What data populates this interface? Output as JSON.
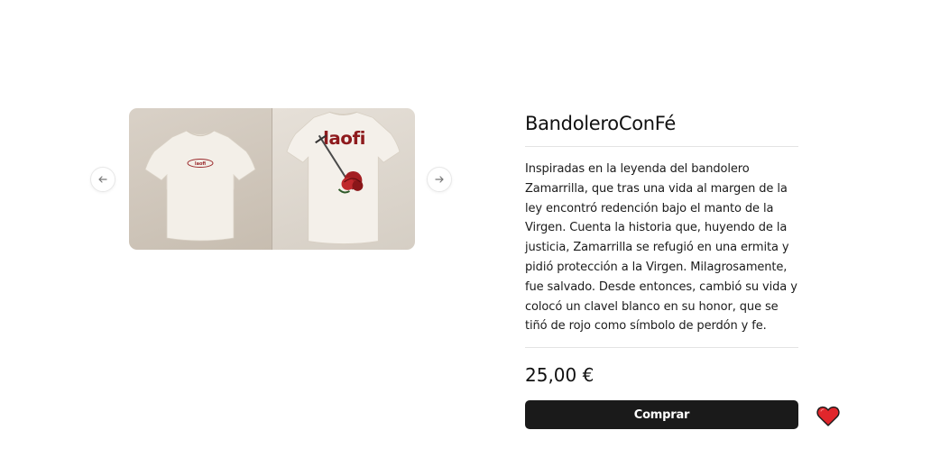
{
  "product": {
    "title": "BandoleroConFé",
    "description": "Inspiradas en la leyenda del bandolero Zamarrilla, que tras una vida al margen de la ley encontró redención bajo el manto de la Virgen. Cuenta la historia que, huyendo de la justicia, Zamarrilla se refugió en una ermita y pidió protección a la Virgen. Milagrosamente, fue salvado. Desde entonces, cambió su vida y colocó un clavel blanco en su honor, que se tiñó de rojo como símbolo de perdón y fe.",
    "price": "25,00 €",
    "buy_label": "Comprar"
  },
  "gallery": {
    "back_print_text": "laofi"
  },
  "icons": {
    "prev": "arrow-left-icon",
    "next": "arrow-right-icon",
    "favorite": "heart-icon"
  },
  "colors": {
    "button_bg": "#1a1a1a",
    "heart_fill": "#e0262b",
    "print_red": "#8e1a1d"
  }
}
